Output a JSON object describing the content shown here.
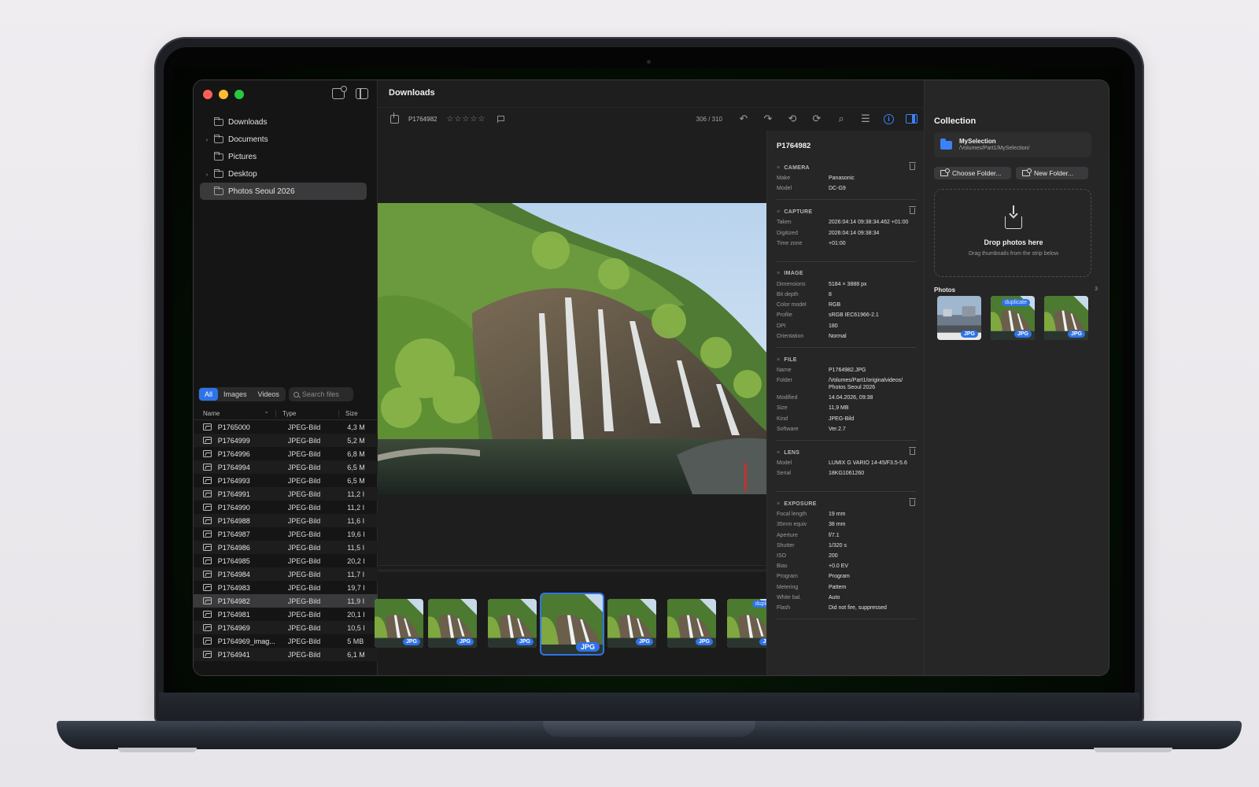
{
  "window": {
    "title": "Downloads"
  },
  "sidebar": {
    "tree": [
      {
        "label": "Downloads",
        "expandable": false,
        "selected": false
      },
      {
        "label": "Documents",
        "expandable": true,
        "selected": false
      },
      {
        "label": "Pictures",
        "expandable": false,
        "selected": false
      },
      {
        "label": "Desktop",
        "expandable": true,
        "selected": false
      },
      {
        "label": "Photos Seoul 2026",
        "expandable": false,
        "selected": true
      }
    ],
    "filters": [
      "All",
      "Images",
      "Videos"
    ],
    "active_filter": "All",
    "search_placeholder": "Search files",
    "columns": {
      "name": "Name",
      "type": "Type",
      "size": "Size"
    },
    "files": [
      {
        "name": "P1765000",
        "type": "JPEG-Bild",
        "size": "4,3 M"
      },
      {
        "name": "P1764999",
        "type": "JPEG-Bild",
        "size": "5,2 M"
      },
      {
        "name": "P1764996",
        "type": "JPEG-Bild",
        "size": "6,8 M"
      },
      {
        "name": "P1764994",
        "type": "JPEG-Bild",
        "size": "6,5 M"
      },
      {
        "name": "P1764993",
        "type": "JPEG-Bild",
        "size": "6,5 M"
      },
      {
        "name": "P1764991",
        "type": "JPEG-Bild",
        "size": "11,2 I"
      },
      {
        "name": "P1764990",
        "type": "JPEG-Bild",
        "size": "11,2 I"
      },
      {
        "name": "P1764988",
        "type": "JPEG-Bild",
        "size": "11,6 I"
      },
      {
        "name": "P1764987",
        "type": "JPEG-Bild",
        "size": "19,6 I"
      },
      {
        "name": "P1764986",
        "type": "JPEG-Bild",
        "size": "11,5 I"
      },
      {
        "name": "P1764985",
        "type": "JPEG-Bild",
        "size": "20,2 I"
      },
      {
        "name": "P1764984",
        "type": "JPEG-Bild",
        "size": "11,7 I"
      },
      {
        "name": "P1764983",
        "type": "JPEG-Bild",
        "size": "19,7 I"
      },
      {
        "name": "P1764982",
        "type": "JPEG-Bild",
        "size": "11,9 I",
        "selected": true
      },
      {
        "name": "P1764981",
        "type": "JPEG-Bild",
        "size": "20,1 I"
      },
      {
        "name": "P1764969",
        "type": "JPEG-Bild",
        "size": "10,5 I"
      },
      {
        "name": "P1764969_imag...",
        "type": "JPEG-Bild",
        "size": "5 MB"
      },
      {
        "name": "P1764941",
        "type": "JPEG-Bild",
        "size": "6,1 M"
      }
    ]
  },
  "toolbar": {
    "filename": "P1764982",
    "rating": 0,
    "rating_max": 5,
    "counter": "306 / 310",
    "icons": [
      "undo-icon",
      "redo-icon",
      "rotate-left-icon",
      "rotate-right-icon",
      "zoom-icon",
      "adjustments-icon",
      "info-icon",
      "inspector-toggle-icon"
    ]
  },
  "strip": {
    "thumbs": [
      {
        "badge": "JPG",
        "duplicate": false,
        "selected": false
      },
      {
        "badge": "JPG",
        "duplicate": false,
        "selected": false
      },
      {
        "badge": "JPG",
        "duplicate": false,
        "selected": false
      },
      {
        "badge": "JPG",
        "duplicate": false,
        "selected": true
      },
      {
        "badge": "JPG",
        "duplicate": false,
        "selected": false
      },
      {
        "badge": "JPG",
        "duplicate": false,
        "selected": false
      },
      {
        "badge": "JP",
        "duplicate": true,
        "duplicate_label": "duplicat",
        "selected": false
      }
    ]
  },
  "inspector": {
    "title": "P1764982",
    "sections": [
      {
        "name": "CAMERA",
        "deletable": true,
        "rows": [
          {
            "k": "Make",
            "v": "Panasonic"
          },
          {
            "k": "Model",
            "v": "DC-G9"
          }
        ]
      },
      {
        "name": "CAPTURE",
        "deletable": true,
        "rows": [
          {
            "k": "Taken",
            "v": "2026:04:14 09:38:34.462 +01:00"
          },
          {
            "k": "Digitized",
            "v": "2026:04:14 09:38:34"
          },
          {
            "k": "Time zone",
            "v": "+01:00"
          }
        ]
      },
      {
        "name": "IMAGE",
        "deletable": false,
        "rows": [
          {
            "k": "Dimensions",
            "v": "5184 × 3888 px"
          },
          {
            "k": "Bit depth",
            "v": "8"
          },
          {
            "k": "Color model",
            "v": "RGB"
          },
          {
            "k": "Profile",
            "v": "sRGB IEC61966-2.1"
          },
          {
            "k": "DPI",
            "v": "180"
          },
          {
            "k": "Orientation",
            "v": "Normal"
          }
        ]
      },
      {
        "name": "FILE",
        "deletable": false,
        "rows": [
          {
            "k": "Name",
            "v": "P1764982.JPG"
          },
          {
            "k": "Folder",
            "v": "/Volumes/Part1/originalvideos/ Photos Seoul 2026"
          },
          {
            "k": "Modified",
            "v": "14.04.2026, 09:38"
          },
          {
            "k": "Size",
            "v": "11,9 MB"
          },
          {
            "k": "Kind",
            "v": "JPEG-Bild"
          },
          {
            "k": "Software",
            "v": "Ver.2.7"
          }
        ]
      },
      {
        "name": "LENS",
        "deletable": true,
        "rows": [
          {
            "k": "Model",
            "v": "LUMIX G VARIO 14-45/F3.5-5.6"
          },
          {
            "k": "Serial",
            "v": "18KG1061260"
          }
        ]
      },
      {
        "name": "EXPOSURE",
        "deletable": true,
        "rows": [
          {
            "k": "Focal length",
            "v": "19 mm"
          },
          {
            "k": "35mm equiv",
            "v": "38 mm"
          },
          {
            "k": "Aperture",
            "v": "f/7.1"
          },
          {
            "k": "Shutter",
            "v": "1/320 s"
          },
          {
            "k": "ISO",
            "v": "200"
          },
          {
            "k": "Bias",
            "v": "+0.0 EV"
          },
          {
            "k": "Program",
            "v": "Program"
          },
          {
            "k": "Metering",
            "v": "Pattern"
          },
          {
            "k": "White bal.",
            "v": "Auto"
          },
          {
            "k": "Flash",
            "v": "Did not fire, suppressed"
          }
        ]
      }
    ]
  },
  "collection": {
    "title": "Collection",
    "folder_name": "MySelection",
    "folder_path": "/Volumes/Part1/MySelection/",
    "choose_folder": "Choose Folder...",
    "new_folder": "New Folder...",
    "drop_title": "Drop photos here",
    "drop_sub": "Drag thumbnails from the strip below",
    "photos_label": "Photos",
    "photos_count": "3",
    "photos": [
      {
        "badge": "JPG",
        "duplicate": false
      },
      {
        "badge": "JPG",
        "duplicate": true,
        "duplicate_label": "duplicate"
      },
      {
        "badge": "JPG",
        "duplicate": false
      }
    ]
  },
  "colors": {
    "accent": "#2f73e8",
    "window_bg": "#1f1f1f",
    "panel_bg": "#262626"
  }
}
